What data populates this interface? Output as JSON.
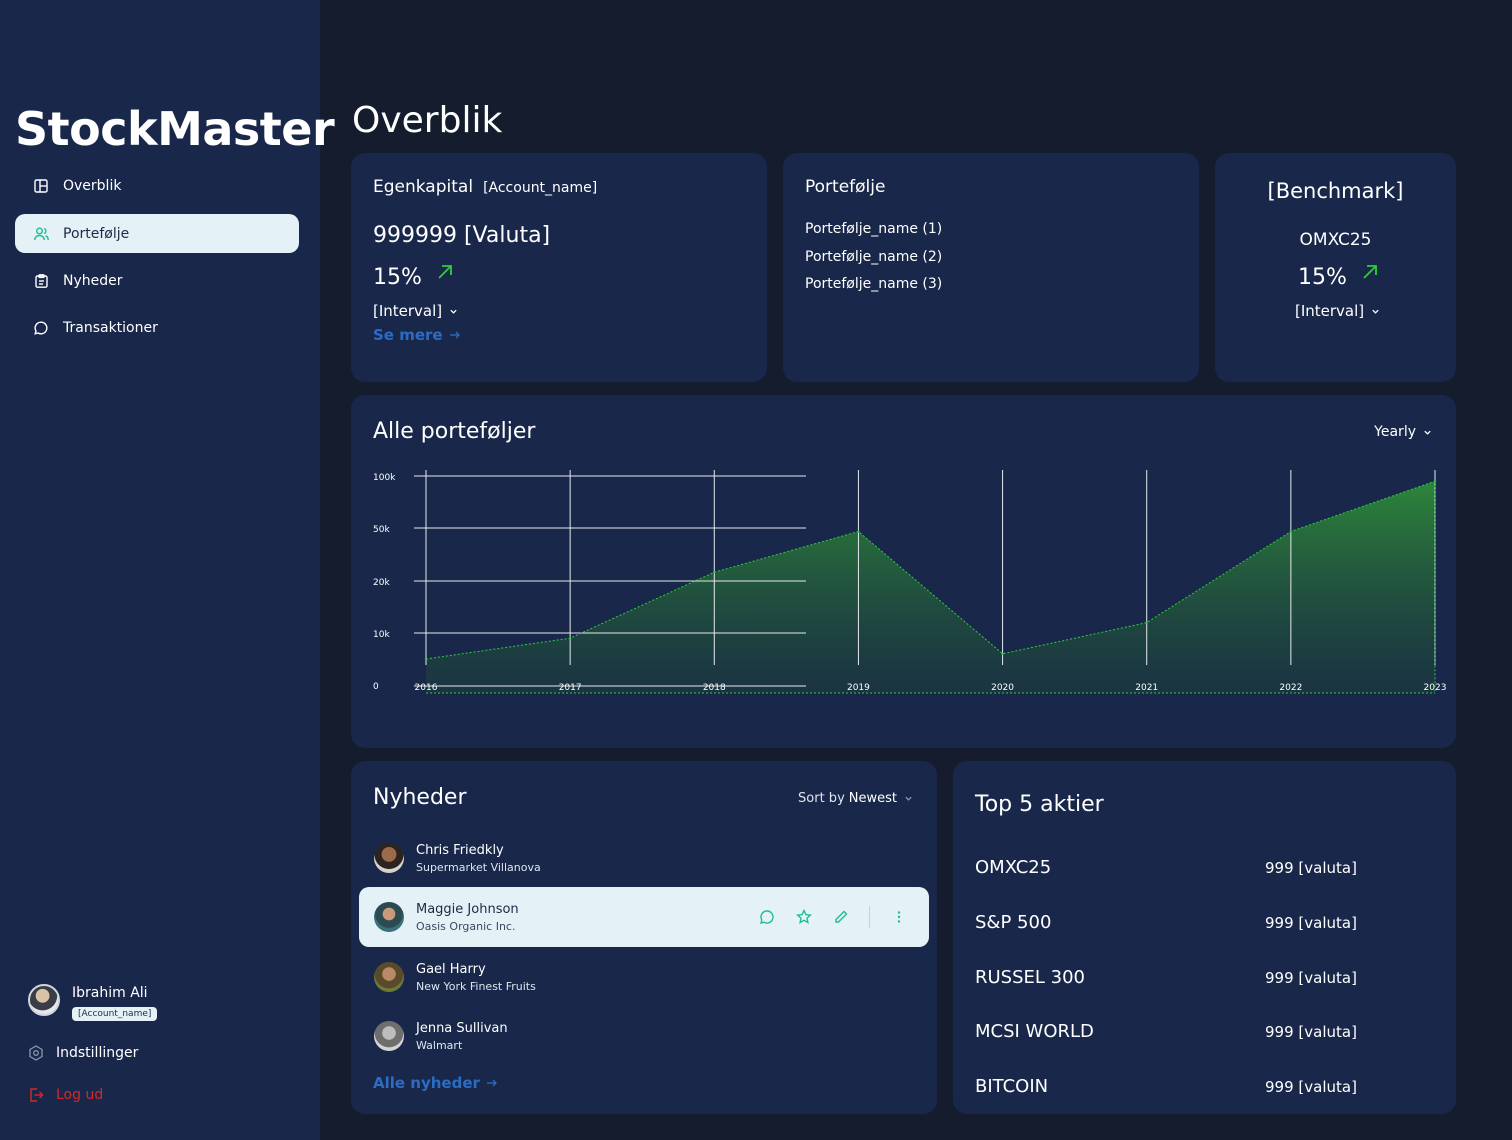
{
  "app": {
    "name": "StockMaster"
  },
  "sidebar": {
    "items": [
      {
        "label": "Overblik",
        "icon": "layout-icon"
      },
      {
        "label": "Portefølje",
        "icon": "users-icon",
        "active": true
      },
      {
        "label": "Nyheder",
        "icon": "clipboard-icon"
      },
      {
        "label": "Transaktioner",
        "icon": "chat-icon"
      }
    ],
    "user": {
      "name": "Ibrahim Ali",
      "account": "[Account_name]"
    },
    "settings_label": "Indstillinger",
    "logout_label": "Log ud"
  },
  "page": {
    "title": "Overblik"
  },
  "equity": {
    "title": "Egenkapital",
    "account": "[Account_name]",
    "value": "999999 [Valuta]",
    "change": "15%",
    "interval": "[Interval]",
    "see_more": "Se mere"
  },
  "portfolio": {
    "title": "Portefølje",
    "items": [
      "Portefølje_name (1)",
      "Portefølje_name (2)",
      "Portefølje_name (3)"
    ]
  },
  "benchmark": {
    "title": "[Benchmark]",
    "index": "OMXC25",
    "change": "15%",
    "interval": "[Interval]"
  },
  "all_portfolios": {
    "title": "Alle porteføljer",
    "period": "Yearly"
  },
  "chart_data": {
    "type": "area",
    "title": "Alle porteføljer",
    "x": [
      "2016",
      "2017",
      "2018",
      "2019",
      "2020",
      "2021",
      "2022",
      "2023"
    ],
    "y_ticks": [
      "100k",
      "50k",
      "20k",
      "10k",
      "0"
    ],
    "y_tick_values": [
      100000,
      50000,
      20000,
      10000,
      0
    ],
    "y_scale": "log-like (categorical ticks)",
    "series": [
      {
        "values": [
          5000,
          9000,
          25000,
          48000,
          6000,
          12000,
          48000,
          95000
        ]
      }
    ],
    "grid": true,
    "legend": "none",
    "color": "#2e7d32"
  },
  "news": {
    "title": "Nyheder",
    "sort_label": "Sort by",
    "sort_value": "Newest",
    "items": [
      {
        "name": "Chris Friedkly",
        "company": "Supermarket Villanova"
      },
      {
        "name": "Maggie Johnson",
        "company": "Oasis Organic Inc.",
        "active": true
      },
      {
        "name": "Gael Harry",
        "company": "New York Finest Fruits"
      },
      {
        "name": "Jenna Sullivan",
        "company": "Walmart"
      }
    ],
    "all_link": "Alle nyheder"
  },
  "top5": {
    "title": "Top 5 aktier",
    "items": [
      {
        "name": "OMXC25",
        "value": "999 [valuta]"
      },
      {
        "name": "S&P 500",
        "value": "999 [valuta]"
      },
      {
        "name": "RUSSEL 300",
        "value": "999 [valuta]"
      },
      {
        "name": "MCSI WORLD",
        "value": "999 [valuta]"
      },
      {
        "name": "BITCOIN",
        "value": "999 [valuta]"
      }
    ]
  },
  "colors": {
    "background": "#141c2e",
    "card": "#19284a",
    "accent": "#1fbf8f",
    "positive": "#2ecc40",
    "link": "#2b6cc4",
    "danger": "#d62828"
  }
}
